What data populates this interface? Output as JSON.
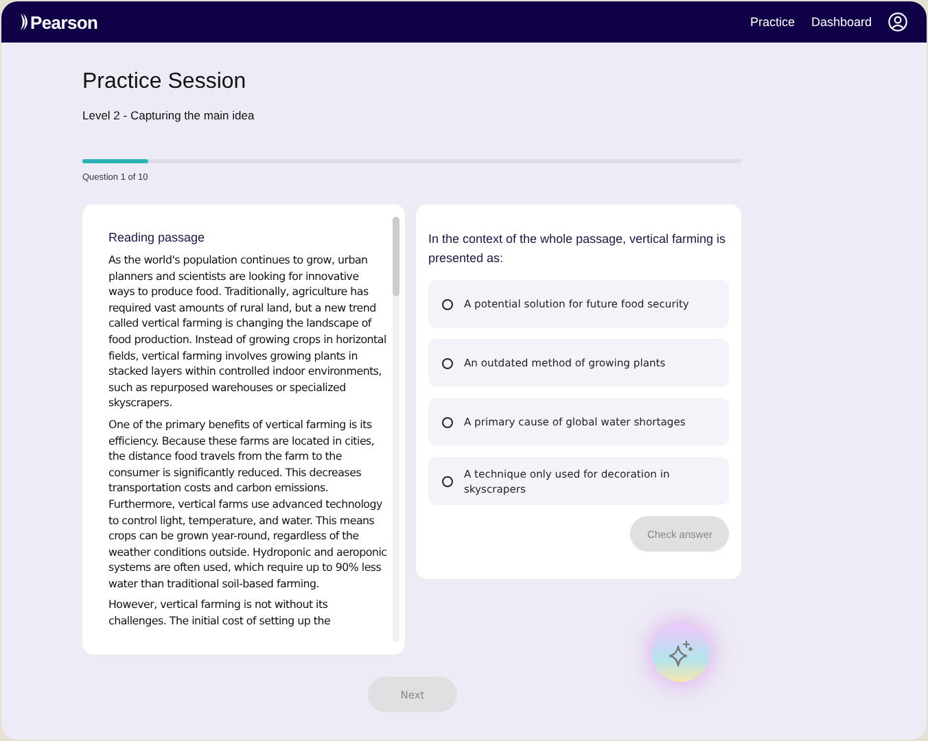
{
  "header": {
    "logo": "Pearson",
    "nav": [
      {
        "label": "Practice"
      },
      {
        "label": "Dashboard"
      }
    ]
  },
  "title": "Practice Session",
  "subtitle": "Level 2 - Capturing the main idea",
  "progress": {
    "level": 0.1,
    "label": "Question 1 of 10"
  },
  "passage": {
    "heading": "Reading passage",
    "paragraphs": [
      "As the world's population continues to grow, urban planners and scientists are looking for innovative ways to produce food. Traditionally, agriculture has required vast amounts of rural land, but a new trend called vertical farming is changing the landscape of food production. Instead of growing crops in horizontal fields, vertical farming involves growing plants in stacked layers within controlled indoor environments, such as repurposed warehouses or specialized skyscrapers.",
      "One of the primary benefits of vertical farming is its efficiency. Because these farms are located in cities, the distance food travels from the farm to the consumer is significantly reduced. This decreases transportation costs and carbon emissions. Furthermore, vertical farms use advanced technology to control light, temperature, and water. This means crops can be grown year-round, regardless of the weather conditions outside. Hydroponic and aeroponic systems are often used, which require up to 90% less water than traditional soil-based farming.",
      "However, vertical farming is not without its challenges. The initial cost of setting up the"
    ]
  },
  "question": {
    "prompt": "In the context of the whole passage, vertical farming is presented as:",
    "options": [
      {
        "label": "A potential solution for future food security",
        "selected": false
      },
      {
        "label": "An outdated method of growing plants",
        "selected": false
      },
      {
        "label": "A primary cause of global water shortages",
        "selected": false
      },
      {
        "label": "A technique only used for decoration in skyscrapers",
        "selected": false
      }
    ],
    "check_button": {
      "label": "Check answer",
      "disabled": true
    }
  },
  "next_button": {
    "label": "Next",
    "disabled": true
  }
}
